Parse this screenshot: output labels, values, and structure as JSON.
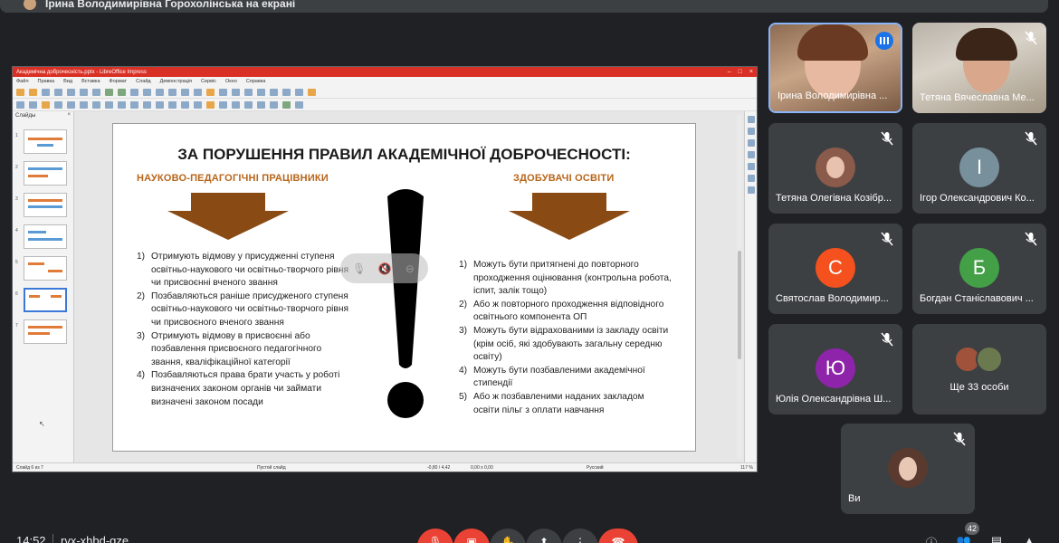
{
  "presenter_banner": {
    "text": "Ірина Володимирівна Горохолінська на екрані"
  },
  "libreoffice": {
    "title": "Академічна доброчесність.pptx - LibreOffice Impress",
    "menu": [
      "Файл",
      "Правка",
      "Вид",
      "Вставка",
      "Формат",
      "Слайд",
      "Демонстрація",
      "Сервіс",
      "Окно",
      "Справка"
    ],
    "slides_panel_title": "Слайды",
    "status": {
      "slide": "Слайд 6 из 7",
      "layout": "Пустой слайд",
      "coords": "-0,80 / 4,42",
      "size": "0,00 x 0,00",
      "language": "Русский",
      "zoom": "117 %"
    }
  },
  "slide": {
    "title": "ЗА ПОРУШЕННЯ ПРАВИЛ АКАДЕМІЧНОЇ ДОБРОЧЕСНОСТІ:",
    "left_heading": "НАУКОВО-ПЕДАГОГІЧНІ ПРАЦІВНИКИ",
    "right_heading": "ЗДОБУВАЧІ ОСВІТИ",
    "left_items": [
      {
        "n": "1)",
        "text": "Отримують відмову у присудженні ступеня освітньо-наукового чи освітньо-творчого рівня чи присвоєнні вченого звання"
      },
      {
        "n": "2)",
        "text": "Позбавляються раніше присудженого ступеня освітньо-наукового чи освітньо-творчого рівня чи присвоєного вченого звання"
      },
      {
        "n": "3)",
        "text": "Отримують відмову в присвоєнні або позбавлення присвоєного педагогічного звання, кваліфікаційної категорії"
      },
      {
        "n": "4)",
        "text": "Позбавляються права брати участь у роботі визначених законом органів чи займати визначені законом посади"
      }
    ],
    "right_items": [
      {
        "n": "1)",
        "text": "Можуть бути притягнені до повторного проходження оцінювання (контрольна робота, іспит, залік тощо)"
      },
      {
        "n": "2)",
        "text": "Або ж повторного проходження відповідного освітнього компонента ОП"
      },
      {
        "n": "3)",
        "text": "Можуть бути відрахованими із закладу освіти (крім осіб, які здобувають загальну середню освіту)"
      },
      {
        "n": "4)",
        "text": "Можуть бути позбавленими академічної стипендії"
      },
      {
        "n": "5)",
        "text": "Або ж позбавленими наданих закладом освіти пільг з оплати навчання"
      }
    ]
  },
  "participants": [
    {
      "name": "Ірина Володимирівна ...",
      "type": "video"
    },
    {
      "name": "Тетяна Вячеславна Ме...",
      "type": "video"
    },
    {
      "name": "Тетяна Олегівна Козібр...",
      "type": "photo"
    },
    {
      "name": "Ігор Олександрович Ко...",
      "initial": "І",
      "color": "#78909c"
    },
    {
      "name": "Святослав Володимир...",
      "initial": "С",
      "color": "#f4511e"
    },
    {
      "name": "Богдан Станіславович ...",
      "initial": "Б",
      "color": "#43a047"
    },
    {
      "name": "Юлія Олександрівна Ш...",
      "initial": "Ю",
      "color": "#8e24aa"
    },
    {
      "name": "Ще 33 особи",
      "type": "more"
    },
    {
      "name": "Ви",
      "type": "photo"
    }
  ],
  "bottom": {
    "time": "14:52",
    "meeting_code": "rvx-xhbd-qze",
    "participants_count": "42"
  },
  "colors": {
    "end_call": "#ea4335",
    "accent": "#b8651a",
    "arrow": "#8a4a14"
  }
}
